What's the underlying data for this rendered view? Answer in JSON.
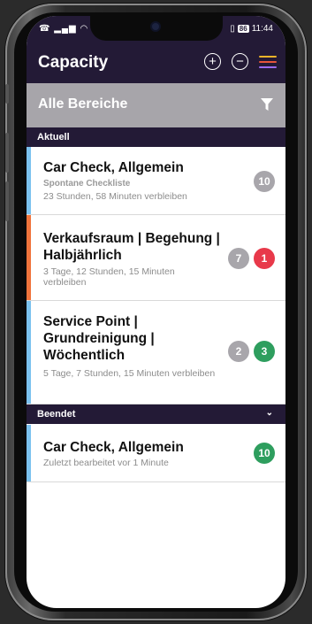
{
  "status_bar": {
    "left_icons": "☎ ▂▄▆ ◠ ✱",
    "battery": "86",
    "time": "11:44"
  },
  "app_bar": {
    "title": "Capacity",
    "add_icon": "plus-circle-icon",
    "remove_icon": "minus-circle-icon",
    "menu_icon": "hamburger-menu-icon",
    "menu_colors": [
      "#f0b429",
      "#e8553a",
      "#9b6cf0"
    ]
  },
  "filter_bar": {
    "label": "Alle Bereiche",
    "icon": "filter-icon"
  },
  "sections": {
    "current": {
      "label": "Aktuell"
    },
    "finished": {
      "label": "Beendet",
      "chevron": "⌄"
    }
  },
  "cards": [
    {
      "title": "Car Check, Allgemein",
      "subtitle": "Spontane Checkliste",
      "meta": "23 Stunden, 58 Minuten verbleiben",
      "stripe_color": "#7cc2ef",
      "badges": [
        {
          "value": "10",
          "color": "#a8a6ab"
        }
      ]
    },
    {
      "title": "Verkaufsraum | Begehung | Halbjährlich",
      "meta": "3 Tage, 12 Stunden, 15 Minuten verbleiben",
      "stripe_color": "#f0743c",
      "badges": [
        {
          "value": "7",
          "color": "#a8a6ab"
        },
        {
          "value": "1",
          "color": "#e8394a"
        }
      ]
    },
    {
      "title": "Service Point | Grundreinigung | Wöchentlich",
      "meta": "5 Tage, 7 Stunden, 15 Minuten verbleiben",
      "stripe_color": "#7cc2ef",
      "badges": [
        {
          "value": "2",
          "color": "#a8a6ab"
        },
        {
          "value": "3",
          "color": "#2e9e5e"
        }
      ]
    }
  ],
  "finished_cards": [
    {
      "title": "Car Check, Allgemein",
      "meta": "Zuletzt bearbeitet vor 1 Minute",
      "stripe_color": "#7cc2ef",
      "badges": [
        {
          "value": "10",
          "color": "#2e9e5e"
        }
      ]
    }
  ]
}
